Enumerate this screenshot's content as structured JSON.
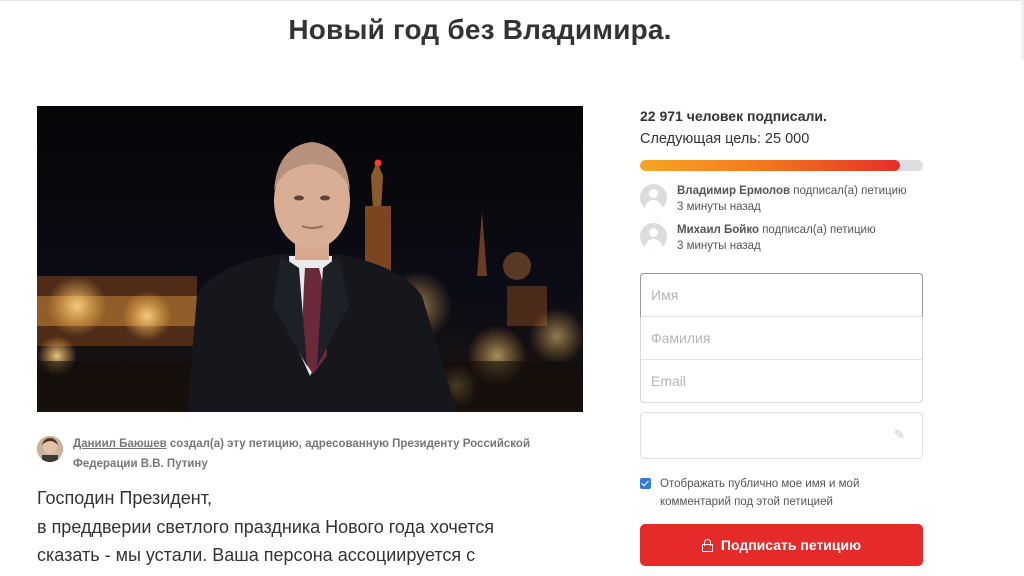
{
  "petition": {
    "title": "Новый год без Владимира.",
    "author": {
      "name": "Даниил Баюшев",
      "created_text": " создал(а) эту петицию, адресованную Президенту Российской Федерации В.В. Путину"
    },
    "body_lines": [
      "Господин Президент,",
      "в преддверии светлого праздника Нового года хочется",
      "сказать - мы устали. Ваша персона ассоциируется с"
    ]
  },
  "stats": {
    "signed_count_text": "22 971 человек подписали.",
    "goal_text": "Следующая цель: 25 000",
    "progress_fraction": 0.9188
  },
  "recent_signers": [
    {
      "name": "Владимир Ермолов",
      "action": " подписал(а) петицию",
      "time": "3 минуты назад"
    },
    {
      "name": "Михаил Бойко",
      "action": " подписал(а) петицию",
      "time": "3 минуты назад"
    }
  ],
  "form": {
    "first_name_placeholder": "Имя",
    "last_name_placeholder": "Фамилия",
    "email_placeholder": "Email",
    "consent_text": "Отображать публично мое имя и мой комментарий под этой петицией",
    "consent_checked": true,
    "submit_label": "Подписать петицию"
  },
  "colors": {
    "accent": "#e52a2a",
    "progress_start": "#f5a623",
    "progress_end": "#e62e2b",
    "checkbox": "#2f7bd8"
  }
}
